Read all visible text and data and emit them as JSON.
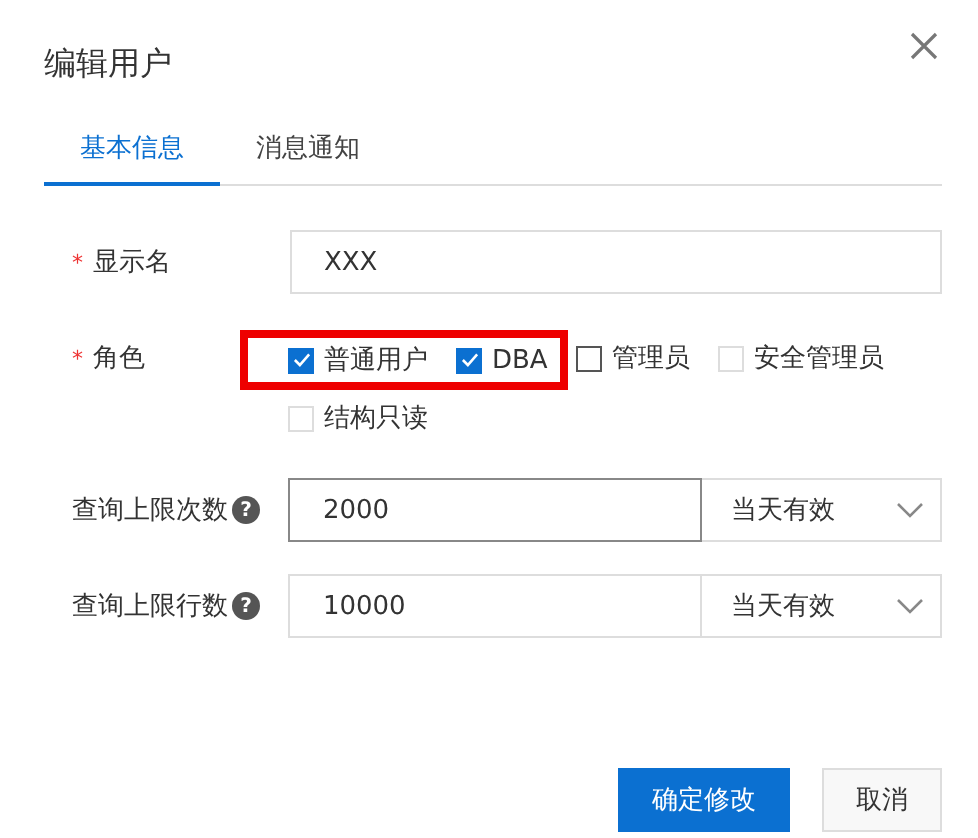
{
  "dialog": {
    "title": "编辑用户"
  },
  "tabs": [
    {
      "label": "基本信息",
      "selected": true
    },
    {
      "label": "消息通知",
      "selected": false
    }
  ],
  "fields": [
    {
      "kind": "text",
      "label": "显示名",
      "required_mark": "*",
      "value": "XXX",
      "focused": false
    },
    {
      "kind": "checkboxes",
      "label": "角色",
      "required_mark": "*",
      "options": [
        {
          "label": "普通用户",
          "checked": true,
          "disabled": false,
          "highlighted": true
        },
        {
          "label": "DBA",
          "checked": true,
          "disabled": false,
          "highlighted": true
        },
        {
          "label": "管理员",
          "checked": false,
          "disabled": false,
          "highlighted": false
        },
        {
          "label": "安全管理员",
          "checked": false,
          "disabled": true,
          "highlighted": false
        },
        {
          "label": "结构只读",
          "checked": false,
          "disabled": true,
          "highlighted": false
        }
      ]
    },
    {
      "kind": "limit",
      "label": "查询上限次数",
      "help": "?",
      "value": "2000",
      "focused": true,
      "period": "当天有效"
    },
    {
      "kind": "limit",
      "label": "查询上限行数",
      "help": "?",
      "value": "10000",
      "focused": false,
      "period": "当天有效"
    }
  ],
  "buttons": [
    {
      "label": "确定修改",
      "primary": true
    },
    {
      "label": "取消",
      "primary": false
    }
  ]
}
